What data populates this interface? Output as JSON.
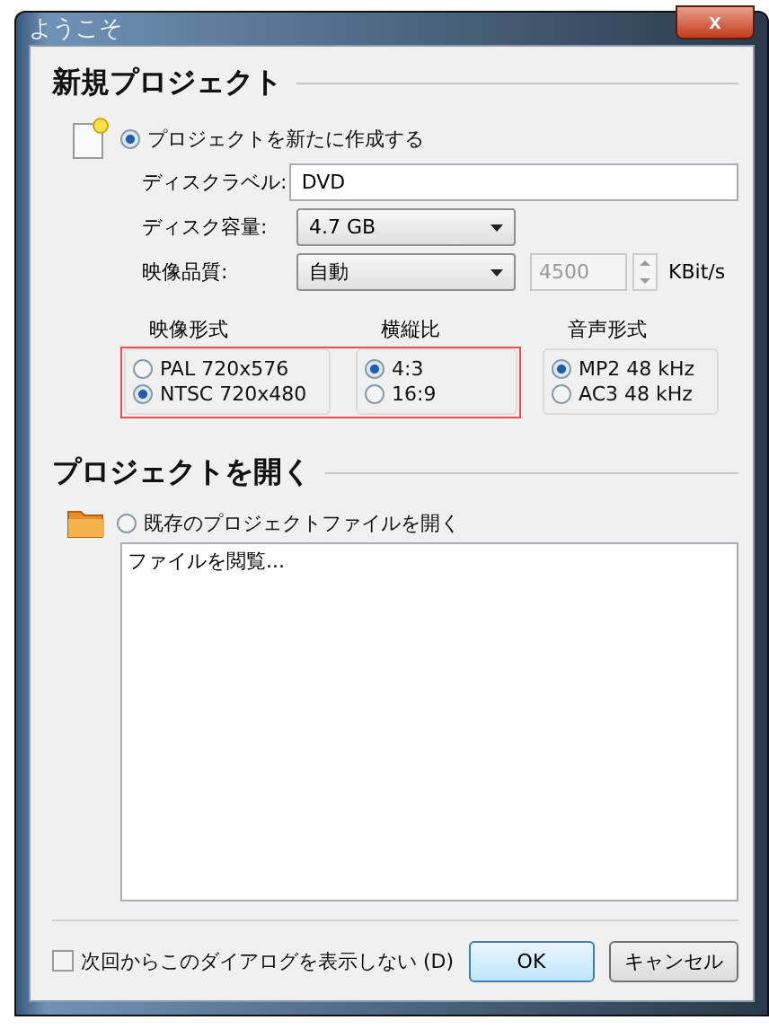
{
  "window": {
    "title": "ようこそ",
    "close": "x"
  },
  "new_project": {
    "heading": "新規プロジェクト",
    "option": {
      "label": "プロジェクトを新たに作成する",
      "selected": true
    },
    "fields": [
      {
        "kind": "text",
        "label": "ディスクラベル:",
        "value": "DVD"
      },
      {
        "kind": "select",
        "label": "ディスク容量:",
        "value": "4.7 GB"
      },
      {
        "kind": "select_spin",
        "label": "映像品質:",
        "value": "自動",
        "spin_value": "4500",
        "spin_disabled": true,
        "unit": "KBit/s"
      }
    ],
    "groups": [
      {
        "title": "映像形式",
        "highlighted": true,
        "options": [
          {
            "label": "PAL 720x576",
            "selected": false
          },
          {
            "label": "NTSC 720x480",
            "selected": true
          }
        ]
      },
      {
        "title": "横縦比",
        "highlighted": true,
        "options": [
          {
            "label": "4:3",
            "selected": true
          },
          {
            "label": "16:9",
            "selected": false
          }
        ]
      },
      {
        "title": "音声形式",
        "highlighted": false,
        "options": [
          {
            "label": "MP2 48 kHz",
            "selected": true
          },
          {
            "label": "AC3 48 kHz",
            "selected": false
          }
        ]
      }
    ]
  },
  "open_project": {
    "heading": "プロジェクトを開く",
    "option": {
      "label": "既存のプロジェクトファイルを開く",
      "selected": false
    },
    "list_items": [
      "ファイルを閲覧..."
    ]
  },
  "footer": {
    "checkbox": {
      "label": "次回からこのダイアログを表示しない (D)",
      "checked": false
    },
    "buttons": [
      {
        "label": "OK",
        "default": true
      },
      {
        "label": "キャンセル",
        "default": false
      }
    ]
  }
}
